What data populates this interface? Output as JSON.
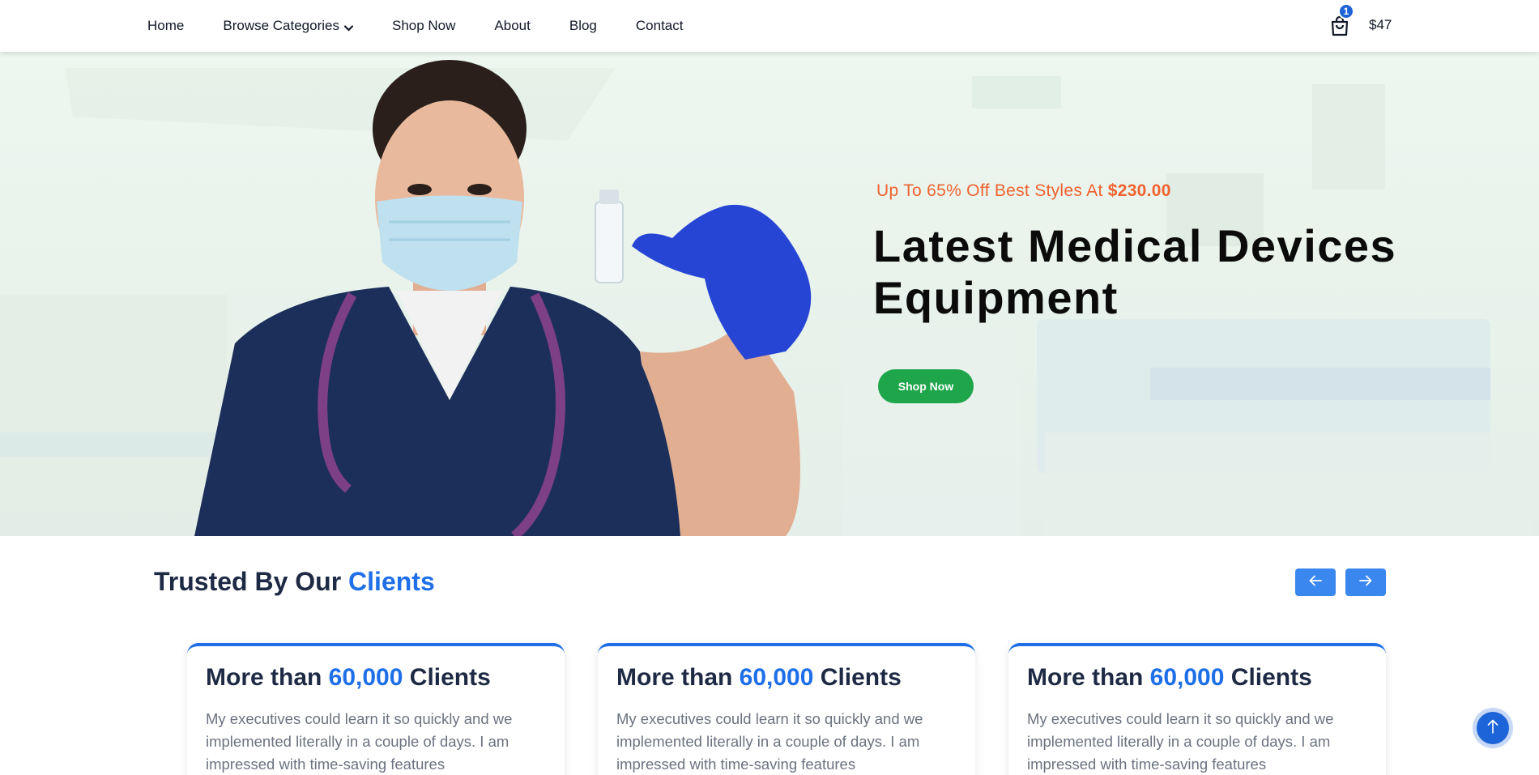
{
  "nav": {
    "items": [
      {
        "label": "Home"
      },
      {
        "label": "Browse Categories"
      },
      {
        "label": "Shop Now"
      },
      {
        "label": "About"
      },
      {
        "label": "Blog"
      },
      {
        "label": "Contact"
      }
    ]
  },
  "cart": {
    "count": "1",
    "total": "$47",
    "icon": "shopping-bag-icon"
  },
  "hero": {
    "subtitle_prefix": "Up To 65% Off Best Styles At ",
    "subtitle_price": "$230.00",
    "title_line1": "Latest Medical Devices",
    "title_line2": "Equipment",
    "button_label": "Shop Now"
  },
  "trusted": {
    "title_prefix": "Trusted By Our ",
    "title_highlight": "Clients",
    "cards": [
      {
        "title_prefix": "More than ",
        "title_number": "60,000",
        "title_suffix": " Clients",
        "text": "My executives could learn it so quickly and we implemented literally in a couple of days. I am impressed with time-saving features"
      },
      {
        "title_prefix": "More than ",
        "title_number": "60,000",
        "title_suffix": " Clients",
        "text": "My executives could learn it so quickly and we implemented literally in a couple of days. I am impressed with time-saving features"
      },
      {
        "title_prefix": "More than ",
        "title_number": "60,000",
        "title_suffix": " Clients",
        "text": "My executives could learn it so quickly and we implemented literally in a couple of days. I am impressed with time-saving features"
      }
    ]
  },
  "colors": {
    "accent_blue": "#1e6fe8",
    "button_green": "#1fa64a",
    "promo_orange": "#f0622f",
    "heading_dark": "#1e2a44"
  }
}
